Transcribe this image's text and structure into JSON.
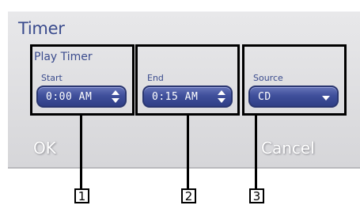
{
  "window": {
    "title": "Timer"
  },
  "play_timer": {
    "group_label": "Play Timer",
    "start": {
      "label": "Start",
      "value": "0:00 AM"
    },
    "end": {
      "label": "End",
      "value": "0:15 AM"
    }
  },
  "source": {
    "label": "Source",
    "value": "CD"
  },
  "buttons": {
    "ok": "OK",
    "cancel": "Cancel"
  },
  "callouts": [
    "1",
    "2",
    "3"
  ],
  "colors": {
    "accent": "#3a4b8d",
    "control": "#3f4f9b",
    "panel": "#dcdcdf"
  }
}
